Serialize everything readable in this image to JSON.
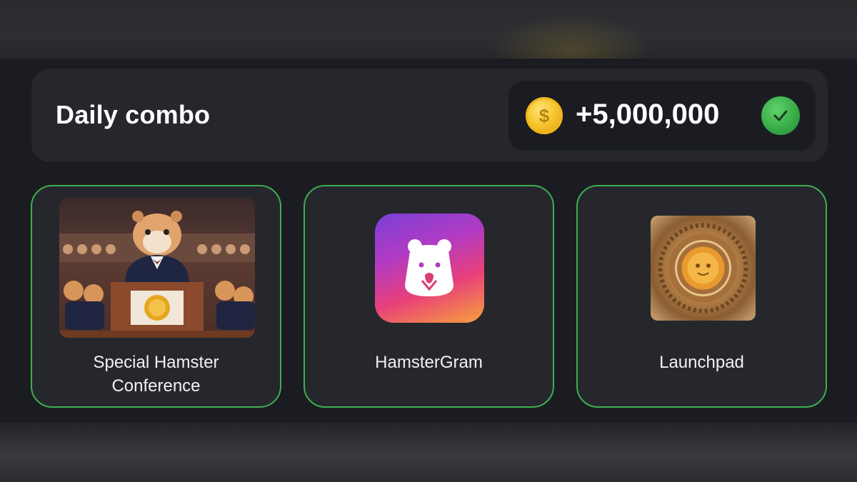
{
  "combo": {
    "title": "Daily combo",
    "reward": "+5,000,000",
    "coin_symbol": "$",
    "icons": {
      "coin": "coin-icon",
      "status": "check-icon"
    }
  },
  "cards": [
    {
      "label_line1": "Special Hamster",
      "label_line2": "Conference",
      "image": "hamster-conference-image"
    },
    {
      "label_line1": "HamsterGram",
      "label_line2": "",
      "image": "hamstergram-app-icon"
    },
    {
      "label_line1": "Launchpad",
      "label_line2": "",
      "image": "launchpad-coin-image"
    }
  ],
  "colors": {
    "panel": "#1a1c21",
    "card": "#25272d",
    "card_border": "#3fae4f",
    "coin": "#f7c52d",
    "check": "#36a845"
  }
}
